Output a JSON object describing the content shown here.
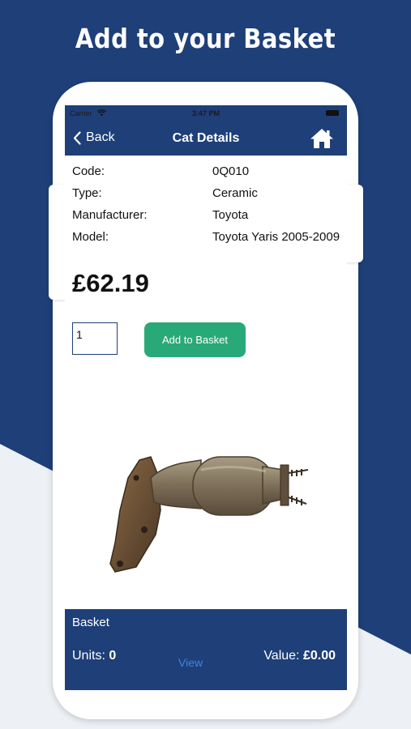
{
  "headline": "Add to your Basket",
  "status_bar": {
    "carrier": "Carrier",
    "time": "3:47 PM"
  },
  "nav": {
    "back_label": "Back",
    "title": "Cat Details",
    "home_icon": "home-icon"
  },
  "details": [
    {
      "label": "Code:",
      "value": "0Q010"
    },
    {
      "label": "Type:",
      "value": "Ceramic"
    },
    {
      "label": "Manufacturer:",
      "value": "Toyota"
    },
    {
      "label": "Model:",
      "value": "Toyota Yaris 2005-2009"
    }
  ],
  "price": "£62.19",
  "quantity": "1",
  "add_button_label": "Add to Basket",
  "basket": {
    "title": "Basket",
    "units_label": "Units:",
    "units_value": "0",
    "view_label": "View",
    "value_label": "Value:",
    "value_amount": "£0.00"
  },
  "colors": {
    "brand_navy": "#1e3f78",
    "add_green": "#2aa978",
    "view_link": "#3c86e6"
  }
}
